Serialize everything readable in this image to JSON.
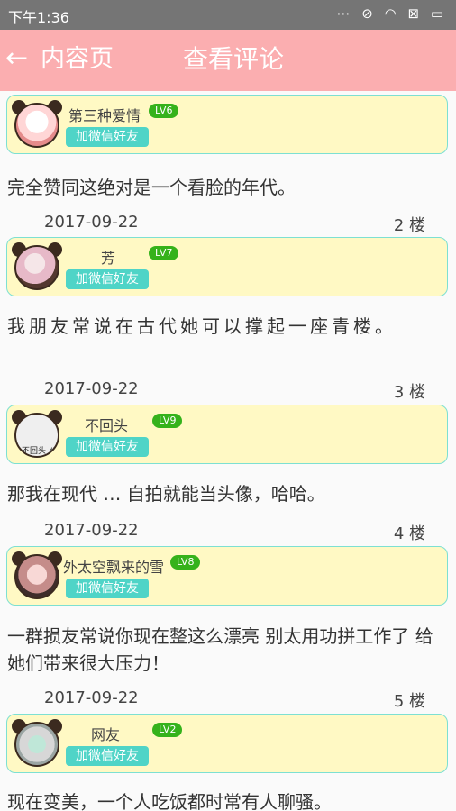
{
  "status_bar": {
    "time": "下午1:36",
    "icons": [
      "more-dots-icon",
      "alarm-off-icon",
      "wifi-icon",
      "sim-icon",
      "battery-icon"
    ],
    "icon_glyphs": "⋯ ⊘ ◠ ⊠ ▭"
  },
  "app_bar": {
    "back_label": "内容页",
    "title": "查看评论",
    "back_glyph": "←",
    "background_color": "#fbaeb0"
  },
  "comments": [
    {
      "username": "第三种爱情",
      "level": "LV6",
      "add_button": "加微信好友",
      "text": "完全赞同这绝对是一个看脸的年代。",
      "date": "2017-09-22",
      "floor": "2 楼"
    },
    {
      "username": "芳",
      "level": "LV7",
      "add_button": "加微信好友",
      "text": "我朋友常说在古代她可以撑起一座青楼。",
      "date": "2017-09-22",
      "floor": "3 楼"
    },
    {
      "username": "不回头",
      "level": "LV9",
      "add_button": "加微信好友",
      "avatar_text": "不回头 #",
      "text": "那我在现代 … 自拍就能当头像，哈哈。",
      "date": "2017-09-22",
      "floor": "4 楼"
    },
    {
      "username": "外太空飘来的雪",
      "level": "LV8",
      "add_button": "加微信好友",
      "text": "一群损友常说你现在整这么漂亮 别太用功拼工作了 给她们带来很大压力！",
      "date": "2017-09-22",
      "floor": "5 楼"
    },
    {
      "username": "网友",
      "level": "LV2",
      "add_button": "加微信好友",
      "text": "现在变美，一个人吃饭都时常有人聊骚。"
    }
  ],
  "colors": {
    "card_background": "#fff9c4",
    "card_border": "#7de0d2",
    "level_badge": "#35b21b",
    "add_button": "#4fd4c7"
  }
}
